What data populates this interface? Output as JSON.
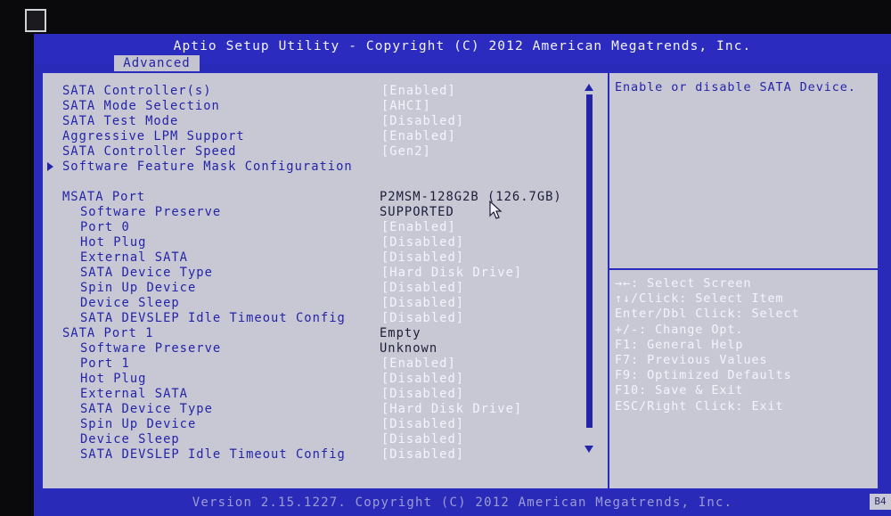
{
  "window": {
    "title": "Aptio Setup Utility - Copyright (C) 2012 American Megatrends, Inc.",
    "active_tab": "Advanced",
    "footer": "Version 2.15.1227. Copyright (C) 2012 American Megatrends, Inc.",
    "corner_code": "B4"
  },
  "settings": [
    {
      "label": "SATA Controller(s)",
      "value": "[Enabled]"
    },
    {
      "label": "SATA Mode Selection",
      "value": "[AHCI]"
    },
    {
      "label": "SATA Test Mode",
      "value": "[Disabled]"
    },
    {
      "label": "Aggressive LPM Support",
      "value": "[Enabled]"
    },
    {
      "label": "SATA Controller Speed",
      "value": "[Gen2]"
    },
    {
      "label": "Software Feature Mask Configuration",
      "value": ""
    },
    {
      "label": "MSATA Port",
      "value": "P2MSM-128G2B   (126.7GB)"
    },
    {
      "label": "Software Preserve",
      "value": "SUPPORTED"
    },
    {
      "label": "Port 0",
      "value": "[Enabled]"
    },
    {
      "label": "Hot Plug",
      "value": "[Disabled]"
    },
    {
      "label": "External SATA",
      "value": "[Disabled]"
    },
    {
      "label": "SATA Device Type",
      "value": "[Hard Disk Drive]"
    },
    {
      "label": "Spin Up Device",
      "value": "[Disabled]"
    },
    {
      "label": "Device Sleep",
      "value": "[Disabled]"
    },
    {
      "label": "SATA DEVSLEP Idle Timeout Config",
      "value": "[Disabled]"
    },
    {
      "label": "SATA Port 1",
      "value": "Empty"
    },
    {
      "label": "Software Preserve",
      "value": "Unknown"
    },
    {
      "label": "Port 1",
      "value": "[Enabled]"
    },
    {
      "label": "Hot Plug",
      "value": "[Disabled]"
    },
    {
      "label": "External SATA",
      "value": "[Disabled]"
    },
    {
      "label": "SATA Device Type",
      "value": "[Hard Disk Drive]"
    },
    {
      "label": "Spin Up Device",
      "value": "[Disabled]"
    },
    {
      "label": "Device Sleep",
      "value": "[Disabled]"
    },
    {
      "label": "SATA DEVSLEP Idle Timeout Config",
      "value": "[Disabled]"
    }
  ],
  "help": {
    "description": "Enable or disable SATA Device.",
    "keys": [
      "→←: Select Screen",
      "↑↓/Click: Select Item",
      "Enter/Dbl Click: Select",
      "+/-: Change Opt.",
      "F1: General Help",
      "F7: Previous Values",
      "F9: Optimized Defaults",
      "F10: Save & Exit",
      "ESC/Right Click: Exit"
    ]
  }
}
